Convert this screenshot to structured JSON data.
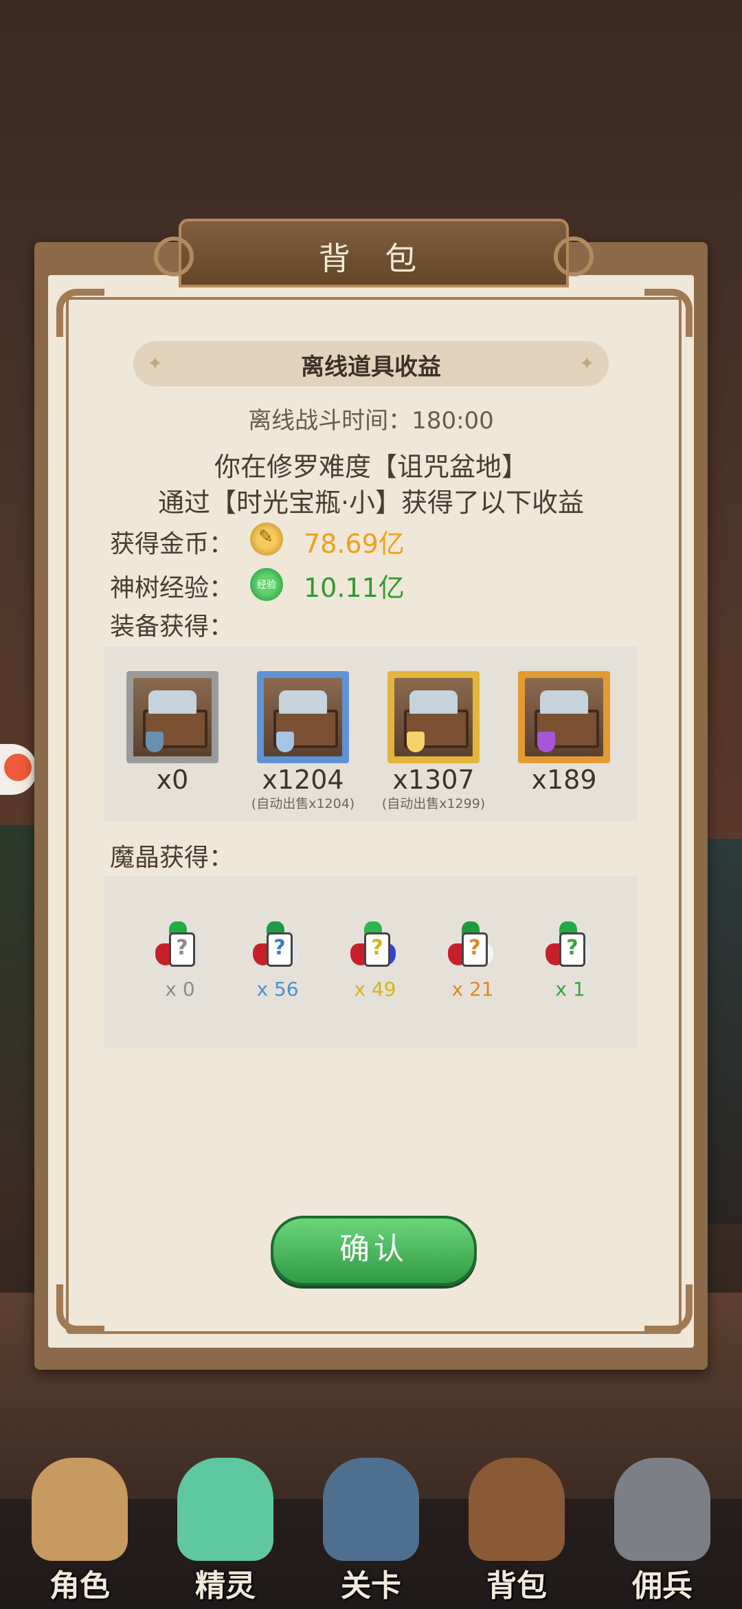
{
  "header": {
    "title": "背 包"
  },
  "panel": {
    "heading": "离线道具收益",
    "battle_time": "离线战斗时间：180:00",
    "message_line1": "你在修罗难度【诅咒盆地】",
    "message_line2": "通过【时光宝瓶·小】获得了以下收益"
  },
  "rewards": {
    "gold_label": "获得金币：",
    "gold_value": "78.69亿",
    "exp_label": "神树经验：",
    "exp_value": "10.11亿",
    "exp_icon_text": "经验",
    "equip_label": "装备获得：",
    "crystal_label": "魔晶获得："
  },
  "equipment": [
    {
      "count": "x0",
      "sub": "",
      "color": "#9a9a9a",
      "shield": "#6a8fb0"
    },
    {
      "count": "x1204",
      "sub": "(自动出售x1204)",
      "color": "#5f93d4",
      "shield": "#a6c4e3"
    },
    {
      "count": "x1307",
      "sub": "(自动出售x1299)",
      "color": "#e3b53a",
      "shield": "#f4d36b"
    },
    {
      "count": "x189",
      "sub": "",
      "color": "#e49a33",
      "shield": "#a756d8"
    }
  ],
  "crystals": [
    {
      "count": "x 0",
      "color": "#8c8c8c",
      "top": "#22aa44",
      "side": "#e0e0ea",
      "q": "#888"
    },
    {
      "count": "x 56",
      "color": "#4a90d9",
      "top": "#1e9b44",
      "side": "#e0e4f0",
      "q": "#3a7bc8"
    },
    {
      "count": "x 49",
      "color": "#d8b21a",
      "top": "#2fb64b",
      "side": "#3344cc",
      "q": "#d8b21a"
    },
    {
      "count": "x 21",
      "color": "#e2861e",
      "top": "#1f9b3e",
      "side": "#f5f5f5",
      "q": "#e2861e"
    },
    {
      "count": "x 1",
      "color": "#3ca33a",
      "top": "#22aa44",
      "side": "#e6e6ee",
      "q": "#3ca33a"
    }
  ],
  "actions": {
    "confirm": "确认"
  },
  "nav": [
    {
      "label": "角色",
      "color": "#c79a62"
    },
    {
      "label": "精灵",
      "color": "#5fc8a0"
    },
    {
      "label": "关卡",
      "color": "#4f6f8f"
    },
    {
      "label": "背包",
      "color": "#8a5a36"
    },
    {
      "label": "佣兵",
      "color": "#7d7f86"
    }
  ],
  "colors": {
    "gold": "#f0a019",
    "exp": "#2f9a2f"
  }
}
